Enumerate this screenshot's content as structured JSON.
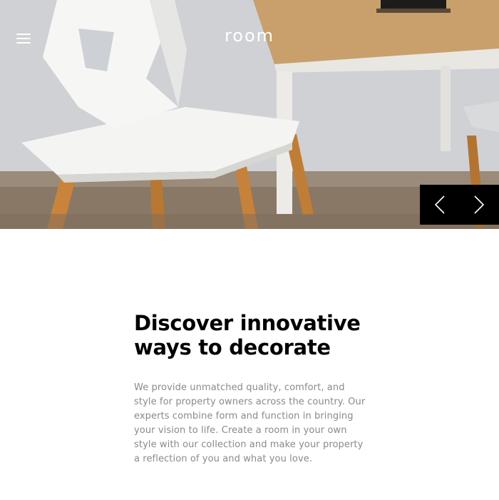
{
  "header": {
    "logo_text": "room",
    "menu_icon": "hamburger-menu-icon"
  },
  "hero": {
    "image_description_icon": "hero-chair-photo",
    "nav": {
      "prev_icon": "chevron-left-icon",
      "next_icon": "chevron-right-icon"
    }
  },
  "about": {
    "heading": "Discover innovative ways to decorate",
    "body": "We provide unmatched quality, comfort, and style for property owners across the country. Our experts combine form and function in bringing your vision to life. Create a room in your own style with our collection and make your property a reflection of you and what you love."
  },
  "colors": {
    "nav_bg": "#000000",
    "heading": "#000000",
    "body_text": "#8a8a8a",
    "logo": "#ffffff"
  }
}
